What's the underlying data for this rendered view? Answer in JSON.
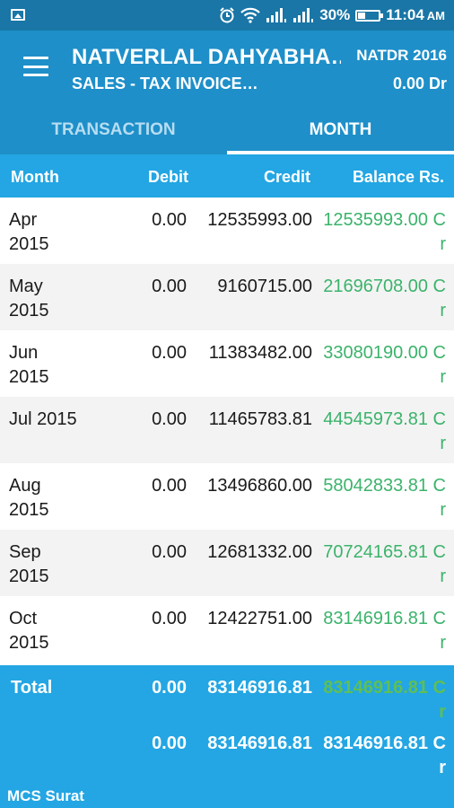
{
  "status_bar": {
    "battery_percent": "30%",
    "time": "11:04",
    "ampm": "AM",
    "icons": [
      "image-icon",
      "alarm-icon",
      "wifi-icon",
      "signal-icon",
      "signal-icon",
      "battery-icon"
    ]
  },
  "header": {
    "title": "NATVERLAL DAHYABHA…",
    "subtitle": "SALES - TAX INVOICE…",
    "code": "NATDR 2016",
    "balance": "0.00 Dr"
  },
  "tabs": [
    {
      "label": "TRANSACTION",
      "active": false
    },
    {
      "label": "MONTH",
      "active": true
    }
  ],
  "columns": {
    "month": "Month",
    "debit": "Debit",
    "credit": "Credit",
    "balance": "Balance Rs."
  },
  "rows": [
    {
      "month": "Apr 2015",
      "debit": "0.00",
      "credit": "12535993.00",
      "balance": "12535993.00 Cr"
    },
    {
      "month": "May 2015",
      "debit": "0.00",
      "credit": "9160715.00",
      "balance": "21696708.00 Cr"
    },
    {
      "month": "Jun 2015",
      "debit": "0.00",
      "credit": "11383482.00",
      "balance": "33080190.00 Cr"
    },
    {
      "month": "Jul 2015",
      "debit": "0.00",
      "credit": "11465783.81",
      "balance": "44545973.81 Cr"
    },
    {
      "month": "Aug 2015",
      "debit": "0.00",
      "credit": "13496860.00",
      "balance": "58042833.81 Cr"
    },
    {
      "month": "Sep 2015",
      "debit": "0.00",
      "credit": "12681332.00",
      "balance": "70724165.81 Cr"
    },
    {
      "month": "Oct 2015",
      "debit": "0.00",
      "credit": "12422751.00",
      "balance": "83146916.81 Cr"
    }
  ],
  "totals": {
    "label": "Total",
    "debit": "0.00",
    "credit": "83146916.81",
    "balance": "83146916.81 Cr"
  },
  "closing": {
    "debit": "0.00",
    "credit": "83146916.81",
    "balance": "83146916.81 Cr"
  },
  "footer_brand": "MCS Surat",
  "colors": {
    "app_bar": "#1e8fc9",
    "status_bar": "#1976a6",
    "header_row": "#23a6e3",
    "balance_green": "#3bb36b"
  }
}
